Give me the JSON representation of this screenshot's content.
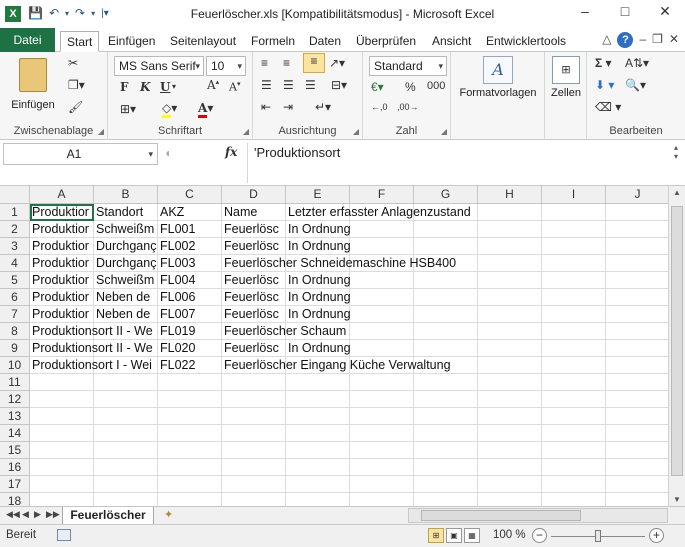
{
  "window": {
    "title": "Feuerlöscher.xls  [Kompatibilitätsmodus]  -  Microsoft Excel",
    "app_icon": "X"
  },
  "qat": {
    "save_icon": "save-icon",
    "undo_icon": "undo-icon",
    "redo_icon": "redo-icon"
  },
  "ribbon_tabs": [
    "Datei",
    "Start",
    "Einfügen",
    "Seitenlayout",
    "Formeln",
    "Daten",
    "Überprüfen",
    "Ansicht",
    "Entwicklertools"
  ],
  "active_tab": "Start",
  "ribbon": {
    "clipboard": {
      "label": "Zwischenablage",
      "paste": "Einfügen"
    },
    "font": {
      "label": "Schriftart",
      "name": "MS Sans Serif",
      "size": "10"
    },
    "alignment": {
      "label": "Ausrichtung"
    },
    "number": {
      "label": "Zahl",
      "format": "Standard",
      "percent": "%",
      "thousands": "000"
    },
    "styles": {
      "label": "Formatvorlagen"
    },
    "cells": {
      "label": "Zellen"
    },
    "editing": {
      "label": "Bearbeiten"
    }
  },
  "formula_bar": {
    "name_box": "A1",
    "fx": "fx",
    "content": "'Produktionsort"
  },
  "grid": {
    "columns": [
      "A",
      "B",
      "C",
      "D",
      "E",
      "F",
      "G",
      "H",
      "I",
      "J"
    ],
    "row_numbers": [
      "1",
      "2",
      "3",
      "4",
      "5",
      "6",
      "7",
      "8",
      "9",
      "10",
      "11",
      "12",
      "13",
      "14",
      "15",
      "16",
      "17",
      "18"
    ],
    "rows": [
      [
        "Produktior",
        "Standort",
        "AKZ",
        "Name",
        "Letzter erfasster Anlagenzustand"
      ],
      [
        "Produktior",
        "Schweißm",
        "FL001",
        "Feuerlösc",
        "In Ordnung"
      ],
      [
        "Produktior",
        "Durchganç",
        "FL002",
        "Feuerlösc",
        "In Ordnung"
      ],
      [
        "Produktior",
        "Durchganç",
        "FL003",
        "Feuerlöscher Schneidemaschine HSB400",
        ""
      ],
      [
        "Produktior",
        "Schweißm",
        "FL004",
        "Feuerlösc",
        "In Ordnung"
      ],
      [
        "Produktior",
        "Neben de",
        "FL006",
        "Feuerlösc",
        "In Ordnung"
      ],
      [
        "Produktior",
        "Neben de",
        "FL007",
        "Feuerlösc",
        "In Ordnung"
      ],
      [
        "Produktionsort II - We",
        "",
        "FL019",
        "Feuerlöscher Schaum",
        ""
      ],
      [
        "Produktionsort II - We",
        "",
        "FL020",
        "Feuerlösc",
        "In Ordnung"
      ],
      [
        "Produktionsort I - Wei",
        "",
        "FL022",
        "Feuerlöscher Eingang Küche Verwaltung",
        ""
      ]
    ]
  },
  "sheets": {
    "active": "Feuerlöscher"
  },
  "status": {
    "ready": "Bereit",
    "zoom": "100 %"
  }
}
